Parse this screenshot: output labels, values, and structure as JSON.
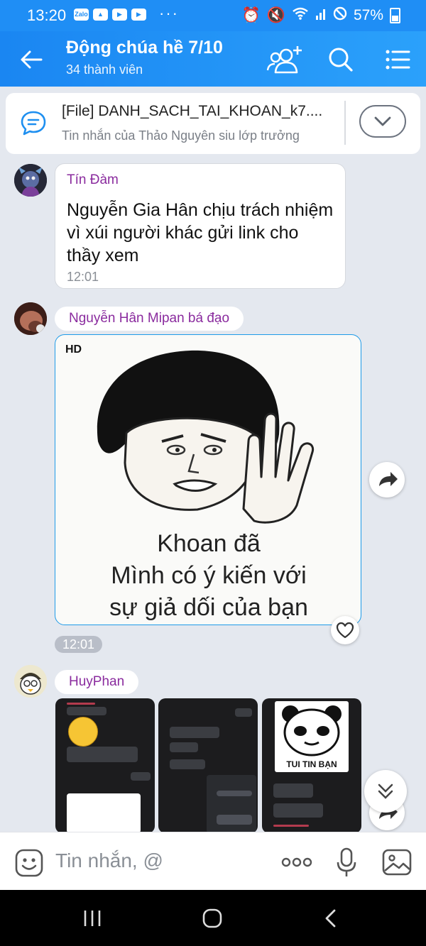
{
  "status_bar": {
    "time": "13:20",
    "app_icons": [
      "Zalo",
      "game-icon",
      "youtube-icon",
      "youtube-icon"
    ],
    "more": "···",
    "battery": "57%"
  },
  "header": {
    "title": "Động chúa hề 7/10",
    "subtitle": "34 thành viên",
    "icons": [
      "back-arrow-icon",
      "add-member-icon",
      "search-icon",
      "menu-icon"
    ]
  },
  "pinned": {
    "title": "[File] DANH_SACH_TAI_KHOAN_k7....",
    "subtitle": "Tin nhắn của Thảo Nguyên siu lớp trưởng"
  },
  "messages": [
    {
      "sender": "Tín Đàm",
      "text": "Nguyễn Gia Hân chịu trách nhiệm vì xúi người khác gửi link cho thầy xem",
      "time": "12:01"
    },
    {
      "sender": "Nguyễn Hân Mipan bá đạo",
      "badge": "HD",
      "caption": [
        "Khoan đã",
        "Mình có ý kiến với",
        "sự giả dối của bạn"
      ],
      "time": "12:01"
    },
    {
      "sender": "HuyPhan",
      "thumbnail_text": "TUI TIN BẠN"
    }
  ],
  "input": {
    "placeholder": "Tin nhắn, @"
  },
  "colors": {
    "header_blue": "#1a86f2",
    "sender_purple": "#8a2b9e",
    "chat_bg": "#e4e8ef"
  }
}
